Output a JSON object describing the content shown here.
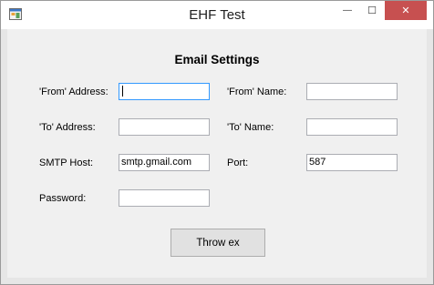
{
  "window": {
    "title": "EHF Test",
    "minimize_glyph": "—",
    "maximize_glyph": "☐",
    "close_glyph": "✕",
    "icon": "application-icon"
  },
  "form": {
    "heading": "Email Settings",
    "fields": {
      "from_address": {
        "label": "'From' Address:",
        "value": ""
      },
      "from_name": {
        "label": "'From' Name:",
        "value": ""
      },
      "to_address": {
        "label": "'To' Address:",
        "value": ""
      },
      "to_name": {
        "label": "'To' Name:",
        "value": ""
      },
      "smtp_host": {
        "label": "SMTP Host:",
        "value": "smtp.gmail.com"
      },
      "port": {
        "label": "Port:",
        "value": "587"
      },
      "password": {
        "label": "Password:",
        "value": ""
      }
    },
    "throw_button_label": "Throw ex"
  },
  "colors": {
    "close_button": "#c75050",
    "focus_border": "#3399ff",
    "client_background": "#f0f0f0"
  }
}
